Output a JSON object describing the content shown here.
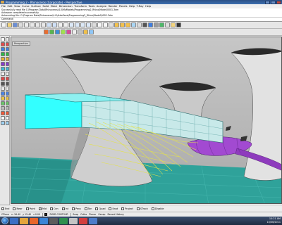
{
  "window": {
    "title": "Programming 2 - Rhinoceros (Corporate) - Perspective",
    "appicon": "rhino-icon"
  },
  "menu": [
    "File",
    "Edit",
    "View",
    "Curve",
    "Surface",
    "Solid",
    "Mesh",
    "Dimension",
    "Transform",
    "Tools",
    "Analyze",
    "Render",
    "Panels",
    "Help",
    "T-Ray",
    "Help"
  ],
  "command_history": {
    "lines": [
      "Successfully read file C:\\Program Data\\Rhinoceros\\4.0\\MyModels\\Programming2_Rhino\\Model\\0001.3dm",
      "Autosave completed successfully",
      "Autocusting file: C:\\Program Data\\Rhinoceros\\4.0\\AutoSave\\Programming2_Rhino\\Model\\0002.3dm",
      "Autosave completed successfully"
    ],
    "prompt_label": "Command:"
  },
  "viewport": {
    "label": "Perspective"
  },
  "osnap": [
    "End",
    "Near",
    "Point",
    "Mid",
    "Cen",
    "Int",
    "Perp",
    "Tan",
    "Quad",
    "Knot",
    "Project",
    "STrack",
    "Disable"
  ],
  "status": {
    "cplane": "CPlane",
    "x": "x -16.40",
    "y": "y 15.40",
    "z": "z 0.00",
    "layer": "RIGID CONTOUR",
    "snap": "Snap",
    "ortho": "Ortho",
    "planar": "Planar",
    "osnap": "Osnap",
    "record_history": "Record History"
  },
  "taskbar": {
    "time": "10:21 AM",
    "date": "10/06/2011"
  },
  "colors": {
    "cyan_block": "#33ffff",
    "teal_ground": "#2fa29a",
    "purple_tube": "#a24ad1",
    "yellow_contours": "#e4e24a",
    "accent": "#3f70b0"
  }
}
